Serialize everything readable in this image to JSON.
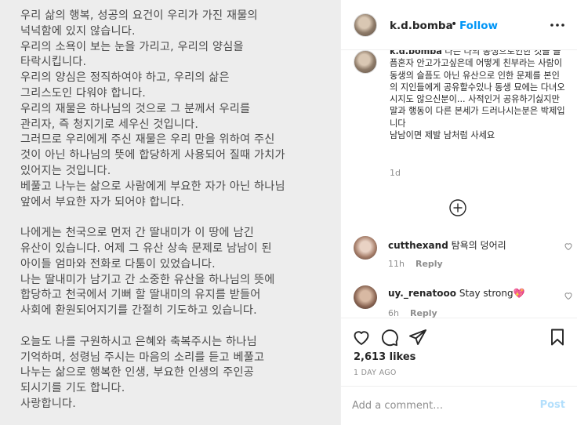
{
  "post_image": {
    "paragraphs": [
      [
        "우리 삶의 행복, 성공의 요건이 우리가 가진 재물의",
        "넉넉함에 있지 않습니다.",
        "우리의 소욕이 보는 눈을 가리고, 우리의 양심을",
        "타락시킵니다.",
        "우리의 양심은 정직하여야 하고,  우리의 삶은",
        "그리스도인 다워야 합니다.",
        "우리의 재물은 하나님의 것으로 그 분께서 우리를",
        "관리자, 즉 청지기로 세우신 것입니다.",
        "그러므로 우리에게 주신 재물은 우리 만을 위하여 주신",
        "것이 아닌 하나님의 뜻에 합당하게 사용되어 질때 가치가",
        "있어지는 것입니다.",
        "베풀고 나누는 삶으로 사람에게 부요한 자가 아닌 하나님",
        "앞에서 부요한 자가  되어야 합니다."
      ],
      [
        "나에게는 천국으로 먼저 간 딸내미가 이 땅에 남긴",
        "유산이 있습니다. 어제 그 유산 상속 문제로 남남이 된",
        "아이들 엄마와 전화로 다툼이 있었습니다.",
        "나는 딸내미가 남기고 간 소중한 유산을 하나님의 뜻에",
        "합당하고 천국에서 기뻐 할 딸내미의 유지를 받들어",
        "사회에 환원되어지기를 간절히 기도하고 있습니다."
      ],
      [
        "오늘도 나를 구원하시고 은혜와 축복주시는 하나님",
        "기억하며, 성령님 주시는 마음의 소리를 듣고 베풀고",
        "나누는 삶으로 행복한 인생, 부요한 인생의 주인공",
        "되시기를 기도 합니다.",
        "사랑합니다."
      ]
    ]
  },
  "header": {
    "username": "k.d.bomba",
    "separator": "•",
    "follow_label": "Follow",
    "more_icon": "more-horizontal-icon"
  },
  "caption": {
    "username": "k.d.bomba",
    "text": "나는 나의 동생으로인한 것을 슬픔혼자 안고가고싶은데 어떻게 친부라는 사람이 동생의 슬픔도 아닌 유산으로 인한 문제를 본인의 지인들에게 공유할수있나 동생 묘에는 다녀오시지도 않으신분이... 사적인거 공유하기싫지만\n말과 행동이 다른 본세가 드러나시는분은 박제입니다\n남남이면 제발 남처럼 사세요",
    "time": "1d"
  },
  "load_more_icon": "plus-circle-icon",
  "comments": [
    {
      "username": "cutthexand",
      "text": "탐욕의 덩어리",
      "time": "11h",
      "reply_label": "Reply"
    },
    {
      "username": "uy._renatooo",
      "text": "Stay strong💖",
      "time": "6h",
      "reply_label": "Reply"
    }
  ],
  "actions": {
    "icons": [
      "heart-icon",
      "comment-icon",
      "share-icon",
      "bookmark-icon"
    ],
    "likes": "2,613 likes",
    "date": "1 DAY AGO"
  },
  "add_comment": {
    "placeholder": "Add a comment…",
    "post_label": "Post"
  }
}
